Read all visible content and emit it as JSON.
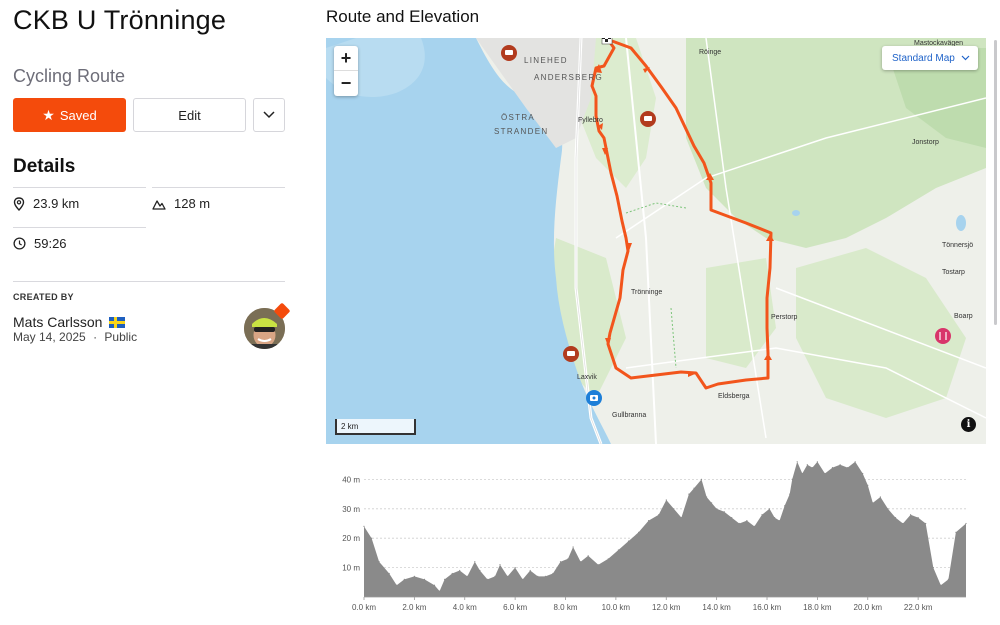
{
  "route": {
    "title": "CKB U Trönninge",
    "type": "Cycling Route"
  },
  "actions": {
    "saved_label": "Saved",
    "edit_label": "Edit"
  },
  "details": {
    "heading": "Details",
    "distance": "23.9 km",
    "elevation_gain": "128 m",
    "moving_time": "59:26"
  },
  "creator": {
    "label": "CREATED BY",
    "name": "Mats Carlsson",
    "date": "May 14, 2025",
    "separator": "·",
    "visibility": "Public"
  },
  "map": {
    "section_title": "Route and Elevation",
    "zoom_in": "+",
    "zoom_out": "−",
    "style_label": "Standard Map",
    "scale_label": "2 km",
    "info_label": "i",
    "route_color": "#f2551c",
    "labels": {
      "linehed": "LINEHED",
      "andersberg": "ANDERSBERG",
      "ostra1": "ÖSTRA",
      "ostra2": "STRANDEN",
      "fyllebro": "Fyllebro",
      "roinge": "Röinge",
      "mastockavagen": "Mastockavägen",
      "jonstorp": "Jonstorp",
      "tonnersjo": "Tönnersjö",
      "tostarp": "Tostarp",
      "boarp": "Boarp",
      "tronninge": "Trönninge",
      "perstorp": "Perstorp",
      "laxvik": "Laxvik",
      "eldsberga": "Eldsberga",
      "gullbranna": "Gullbranna"
    }
  },
  "chart_data": {
    "type": "area",
    "title": "",
    "xlabel": "",
    "ylabel": "",
    "x_ticks": [
      "0.0 km",
      "2.0 km",
      "4.0 km",
      "6.0 km",
      "8.0 km",
      "10.0 km",
      "12.0 km",
      "14.0 km",
      "16.0 km",
      "18.0 km",
      "20.0 km",
      "22.0 km"
    ],
    "y_ticks": [
      "10 m",
      "20 m",
      "30 m",
      "40 m"
    ],
    "xlim": [
      0,
      23.9
    ],
    "ylim": [
      0,
      50
    ],
    "grid": true,
    "color": "#8a8a8a",
    "x": [
      0,
      0.3,
      0.6,
      1.0,
      1.3,
      1.6,
      2.0,
      2.4,
      2.8,
      3.0,
      3.2,
      3.5,
      3.8,
      4.1,
      4.4,
      4.6,
      4.9,
      5.2,
      5.4,
      5.7,
      6.0,
      6.3,
      6.6,
      6.9,
      7.2,
      7.5,
      7.8,
      8.1,
      8.3,
      8.6,
      8.9,
      9.3,
      9.7,
      10.1,
      10.5,
      10.9,
      11.3,
      11.7,
      12.0,
      12.3,
      12.6,
      12.9,
      13.1,
      13.4,
      13.6,
      13.8,
      14.0,
      14.3,
      14.6,
      14.9,
      15.2,
      15.5,
      15.8,
      16.1,
      16.3,
      16.5,
      16.7,
      16.9,
      17.0,
      17.2,
      17.4,
      17.6,
      17.8,
      18.0,
      18.3,
      18.6,
      18.9,
      19.2,
      19.5,
      19.8,
      20.0,
      20.2,
      20.5,
      20.8,
      21.1,
      21.4,
      21.7,
      22.0,
      22.3,
      22.6,
      22.9,
      23.2,
      23.5,
      23.9
    ],
    "y": [
      24,
      20,
      12,
      8,
      4,
      6,
      7,
      6,
      4,
      2,
      6,
      8,
      9,
      7,
      12,
      9,
      6,
      7,
      11,
      7,
      10,
      6,
      9,
      7,
      7,
      8,
      12,
      13,
      17,
      12,
      14,
      11,
      13,
      16,
      19,
      22,
      26,
      28,
      33,
      30,
      27,
      35,
      37,
      40,
      34,
      32,
      30,
      29,
      27,
      25,
      26,
      24,
      28,
      30,
      27,
      26,
      31,
      35,
      40,
      46,
      42,
      45,
      44,
      46,
      42,
      44,
      45,
      44,
      46,
      42,
      38,
      32,
      34,
      30,
      27,
      25,
      28,
      27,
      25,
      10,
      4,
      6,
      22,
      25
    ]
  }
}
